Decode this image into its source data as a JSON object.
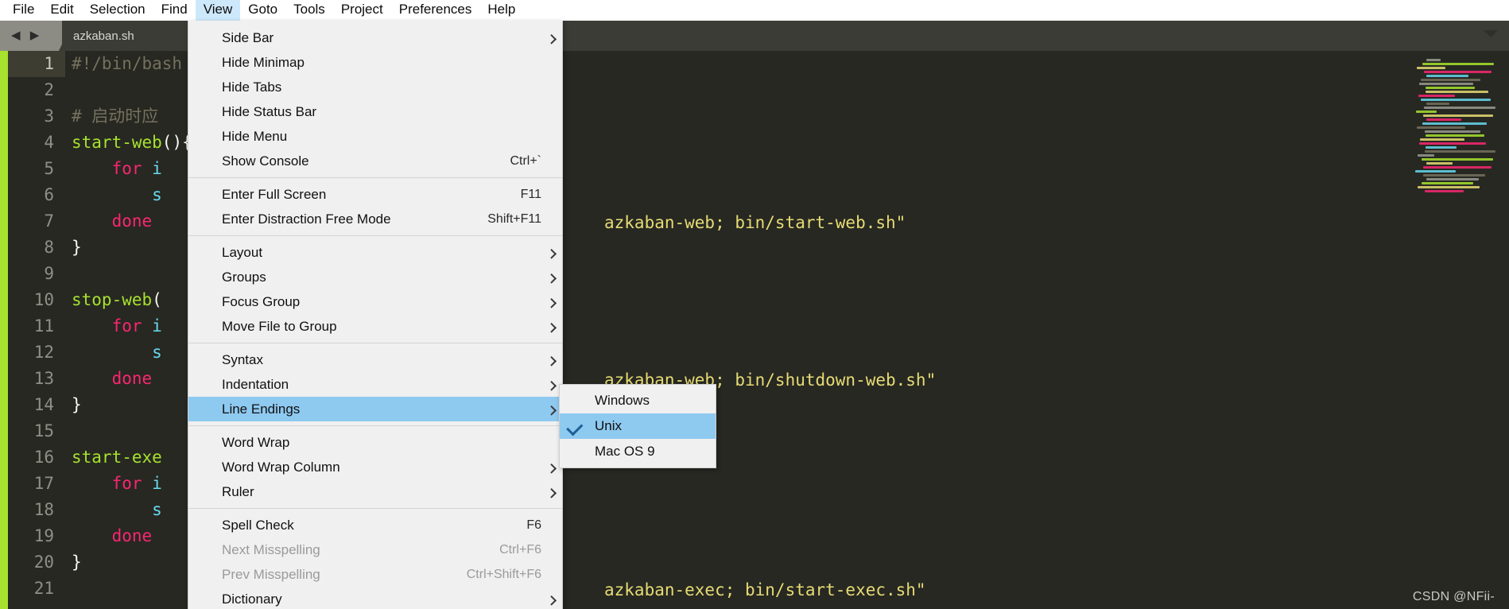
{
  "menubar": {
    "items": [
      {
        "label": "File",
        "active": false
      },
      {
        "label": "Edit",
        "active": false
      },
      {
        "label": "Selection",
        "active": false
      },
      {
        "label": "Find",
        "active": false
      },
      {
        "label": "View",
        "active": true
      },
      {
        "label": "Goto",
        "active": false
      },
      {
        "label": "Tools",
        "active": false
      },
      {
        "label": "Project",
        "active": false
      },
      {
        "label": "Preferences",
        "active": false
      },
      {
        "label": "Help",
        "active": false
      }
    ]
  },
  "tabstrip": {
    "nav_arrows": "◀ ▶",
    "tab_label": "azkaban.sh"
  },
  "view_menu": {
    "groups": [
      [
        {
          "label": "Side Bar",
          "shortcut": "",
          "arrow": true,
          "disabled": false,
          "selected": false
        },
        {
          "label": "Hide Minimap",
          "shortcut": "",
          "arrow": false,
          "disabled": false,
          "selected": false
        },
        {
          "label": "Hide Tabs",
          "shortcut": "",
          "arrow": false,
          "disabled": false,
          "selected": false
        },
        {
          "label": "Hide Status Bar",
          "shortcut": "",
          "arrow": false,
          "disabled": false,
          "selected": false
        },
        {
          "label": "Hide Menu",
          "shortcut": "",
          "arrow": false,
          "disabled": false,
          "selected": false
        },
        {
          "label": "Show Console",
          "shortcut": "Ctrl+`",
          "arrow": false,
          "disabled": false,
          "selected": false
        }
      ],
      [
        {
          "label": "Enter Full Screen",
          "shortcut": "F11",
          "arrow": false,
          "disabled": false,
          "selected": false
        },
        {
          "label": "Enter Distraction Free Mode",
          "shortcut": "Shift+F11",
          "arrow": false,
          "disabled": false,
          "selected": false
        }
      ],
      [
        {
          "label": "Layout",
          "shortcut": "",
          "arrow": true,
          "disabled": false,
          "selected": false
        },
        {
          "label": "Groups",
          "shortcut": "",
          "arrow": true,
          "disabled": false,
          "selected": false
        },
        {
          "label": "Focus Group",
          "shortcut": "",
          "arrow": true,
          "disabled": false,
          "selected": false
        },
        {
          "label": "Move File to Group",
          "shortcut": "",
          "arrow": true,
          "disabled": false,
          "selected": false
        }
      ],
      [
        {
          "label": "Syntax",
          "shortcut": "",
          "arrow": true,
          "disabled": false,
          "selected": false
        },
        {
          "label": "Indentation",
          "shortcut": "",
          "arrow": true,
          "disabled": false,
          "selected": false
        },
        {
          "label": "Line Endings",
          "shortcut": "",
          "arrow": true,
          "disabled": false,
          "selected": true
        }
      ],
      [
        {
          "label": "Word Wrap",
          "shortcut": "",
          "arrow": false,
          "disabled": false,
          "selected": false
        },
        {
          "label": "Word Wrap Column",
          "shortcut": "",
          "arrow": true,
          "disabled": false,
          "selected": false
        },
        {
          "label": "Ruler",
          "shortcut": "",
          "arrow": true,
          "disabled": false,
          "selected": false
        }
      ],
      [
        {
          "label": "Spell Check",
          "shortcut": "F6",
          "arrow": false,
          "disabled": false,
          "selected": false
        },
        {
          "label": "Next Misspelling",
          "shortcut": "Ctrl+F6",
          "arrow": false,
          "disabled": true,
          "selected": false
        },
        {
          "label": "Prev Misspelling",
          "shortcut": "Ctrl+Shift+F6",
          "arrow": false,
          "disabled": true,
          "selected": false
        },
        {
          "label": "Dictionary",
          "shortcut": "",
          "arrow": true,
          "disabled": false,
          "selected": false
        }
      ]
    ]
  },
  "line_endings_submenu": {
    "items": [
      {
        "label": "Windows",
        "checked": false,
        "selected": false
      },
      {
        "label": "Unix",
        "checked": true,
        "selected": true
      },
      {
        "label": "Mac OS 9",
        "checked": false,
        "selected": false
      }
    ]
  },
  "editor": {
    "lines": [
      {
        "num": "1",
        "current": true,
        "tokens": [
          {
            "t": "#!/bin/bash",
            "c": "t-comment"
          }
        ]
      },
      {
        "num": "2",
        "current": false,
        "tokens": []
      },
      {
        "num": "3",
        "current": false,
        "tokens": [
          {
            "t": "# 启动时应",
            "c": "t-comment"
          }
        ]
      },
      {
        "num": "4",
        "current": false,
        "tokens": [
          {
            "t": "start-web",
            "c": "t-fn"
          },
          {
            "t": "(){",
            "c": "t-plain"
          }
        ]
      },
      {
        "num": "5",
        "current": false,
        "tokens": [
          {
            "t": "    ",
            "c": "t-plain"
          },
          {
            "t": "for",
            "c": "t-kw"
          },
          {
            "t": " i",
            "c": "t-var"
          }
        ]
      },
      {
        "num": "6",
        "current": false,
        "tokens": [
          {
            "t": "        ",
            "c": "t-plain"
          },
          {
            "t": "s",
            "c": "t-var"
          }
        ]
      },
      {
        "num": "7",
        "current": false,
        "tokens": [
          {
            "t": "    ",
            "c": "t-plain"
          },
          {
            "t": "done",
            "c": "t-kw"
          }
        ]
      },
      {
        "num": "8",
        "current": false,
        "tokens": [
          {
            "t": "}",
            "c": "t-plain"
          }
        ]
      },
      {
        "num": "9",
        "current": false,
        "tokens": []
      },
      {
        "num": "10",
        "current": false,
        "tokens": [
          {
            "t": "stop-web",
            "c": "t-fn"
          },
          {
            "t": "(",
            "c": "t-plain"
          }
        ]
      },
      {
        "num": "11",
        "current": false,
        "tokens": [
          {
            "t": "    ",
            "c": "t-plain"
          },
          {
            "t": "for",
            "c": "t-kw"
          },
          {
            "t": " i",
            "c": "t-var"
          }
        ]
      },
      {
        "num": "12",
        "current": false,
        "tokens": [
          {
            "t": "        ",
            "c": "t-plain"
          },
          {
            "t": "s",
            "c": "t-var"
          }
        ]
      },
      {
        "num": "13",
        "current": false,
        "tokens": [
          {
            "t": "    ",
            "c": "t-plain"
          },
          {
            "t": "done",
            "c": "t-kw"
          }
        ]
      },
      {
        "num": "14",
        "current": false,
        "tokens": [
          {
            "t": "}",
            "c": "t-plain"
          }
        ]
      },
      {
        "num": "15",
        "current": false,
        "tokens": []
      },
      {
        "num": "16",
        "current": false,
        "tokens": [
          {
            "t": "start-exe",
            "c": "t-fn"
          }
        ]
      },
      {
        "num": "17",
        "current": false,
        "tokens": [
          {
            "t": "    ",
            "c": "t-plain"
          },
          {
            "t": "for",
            "c": "t-kw"
          },
          {
            "t": " i",
            "c": "t-var"
          }
        ]
      },
      {
        "num": "18",
        "current": false,
        "tokens": [
          {
            "t": "        ",
            "c": "t-plain"
          },
          {
            "t": "s",
            "c": "t-var"
          }
        ]
      },
      {
        "num": "19",
        "current": false,
        "tokens": [
          {
            "t": "    ",
            "c": "t-plain"
          },
          {
            "t": "done",
            "c": "t-kw"
          }
        ]
      },
      {
        "num": "20",
        "current": false,
        "tokens": [
          {
            "t": "}",
            "c": "t-plain"
          }
        ]
      },
      {
        "num": "21",
        "current": false,
        "tokens": []
      }
    ],
    "right_fragments": [
      {
        "top": "200",
        "text": "azkaban-web; bin/start-web.sh\"",
        "color": "t-str"
      },
      {
        "top": "398",
        "text": "azkaban-web; bin/shutdown-web.sh\"",
        "color": "t-str"
      },
      {
        "top": "662",
        "text": "azkaban-exec; bin/start-exec.sh\"",
        "color": "t-str"
      }
    ]
  },
  "watermark": {
    "text": "CSDN @NFii-"
  },
  "colors": {
    "editor_bg": "#272822",
    "accent_green": "#a6e22e",
    "menu_bg": "#f0f0f0",
    "highlight": "#8ec9f0",
    "menubar_active": "#cde8fb",
    "string": "#e6db74",
    "keyword": "#f92672",
    "comment": "#75715e"
  }
}
